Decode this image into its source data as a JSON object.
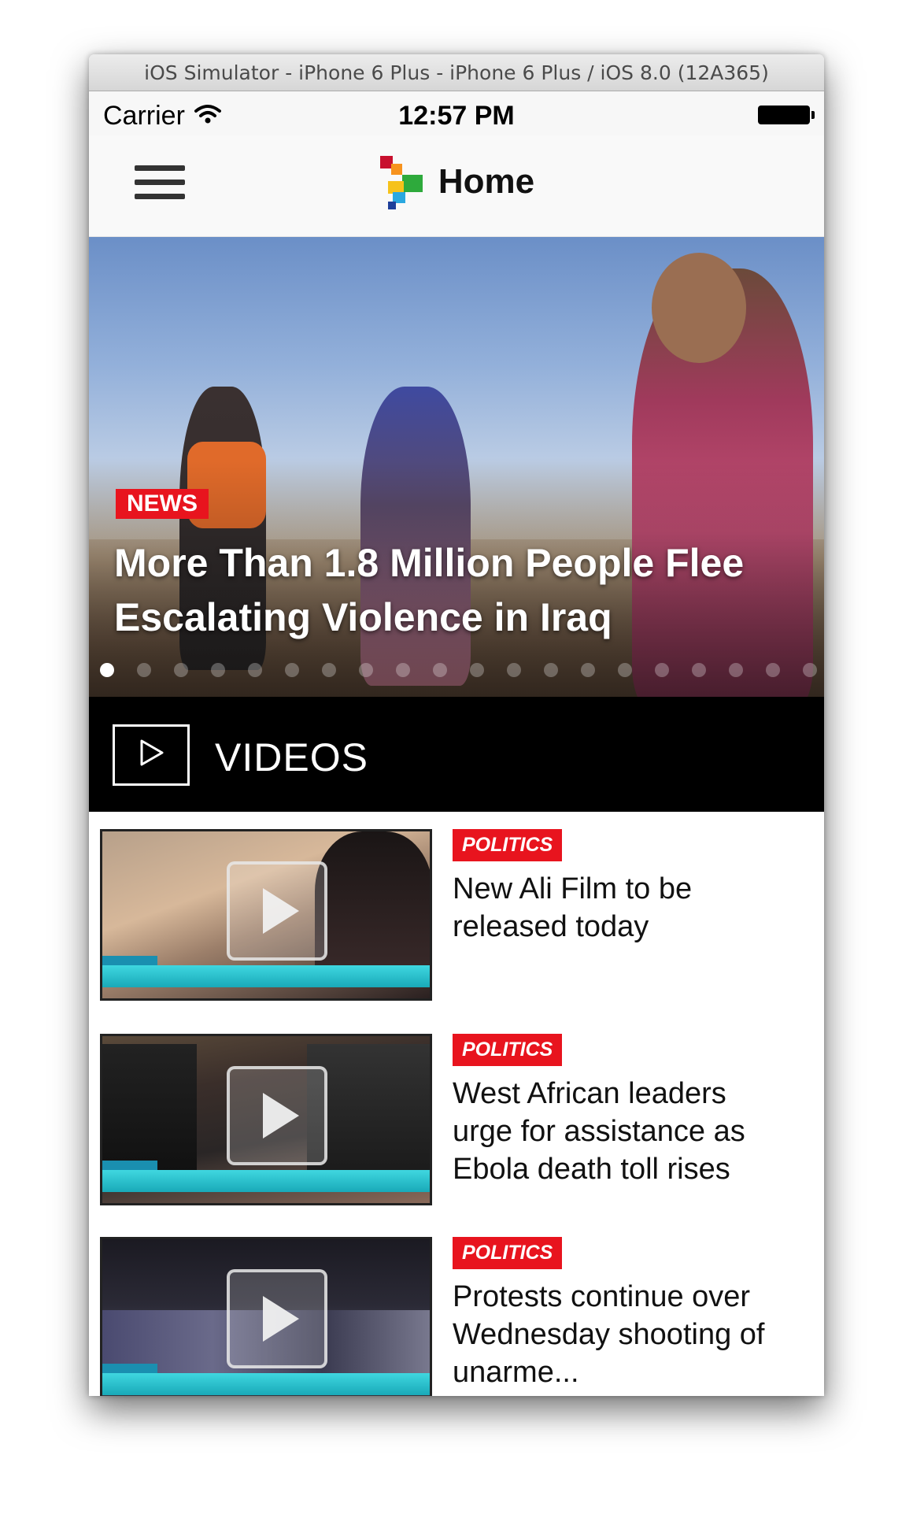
{
  "window": {
    "title": "iOS Simulator - iPhone 6 Plus - iPhone 6 Plus / iOS 8.0 (12A365)"
  },
  "status": {
    "carrier": "Carrier",
    "time": "12:57 PM"
  },
  "nav": {
    "title": "Home",
    "menu_icon": "hamburger-menu-icon",
    "logo_icon": "app-logo-icon"
  },
  "hero": {
    "category": "NEWS",
    "title": "More Than 1.8 Million People Flee Escalating Violence in Iraq",
    "page_count": 20,
    "active_page": 1
  },
  "videos": {
    "header": "VIDEOS",
    "items": [
      {
        "category": "POLITICS",
        "title": "New Ali Film to be released today"
      },
      {
        "category": "POLITICS",
        "title": "West African leaders urge for assistance as Ebola death toll rises"
      },
      {
        "category": "POLITICS",
        "title": "Protests continue over Wednesday shooting of unarme..."
      }
    ]
  },
  "colors": {
    "accent": "#e8141e",
    "header_bg": "#000000",
    "ticker": "#2cc4d0"
  }
}
